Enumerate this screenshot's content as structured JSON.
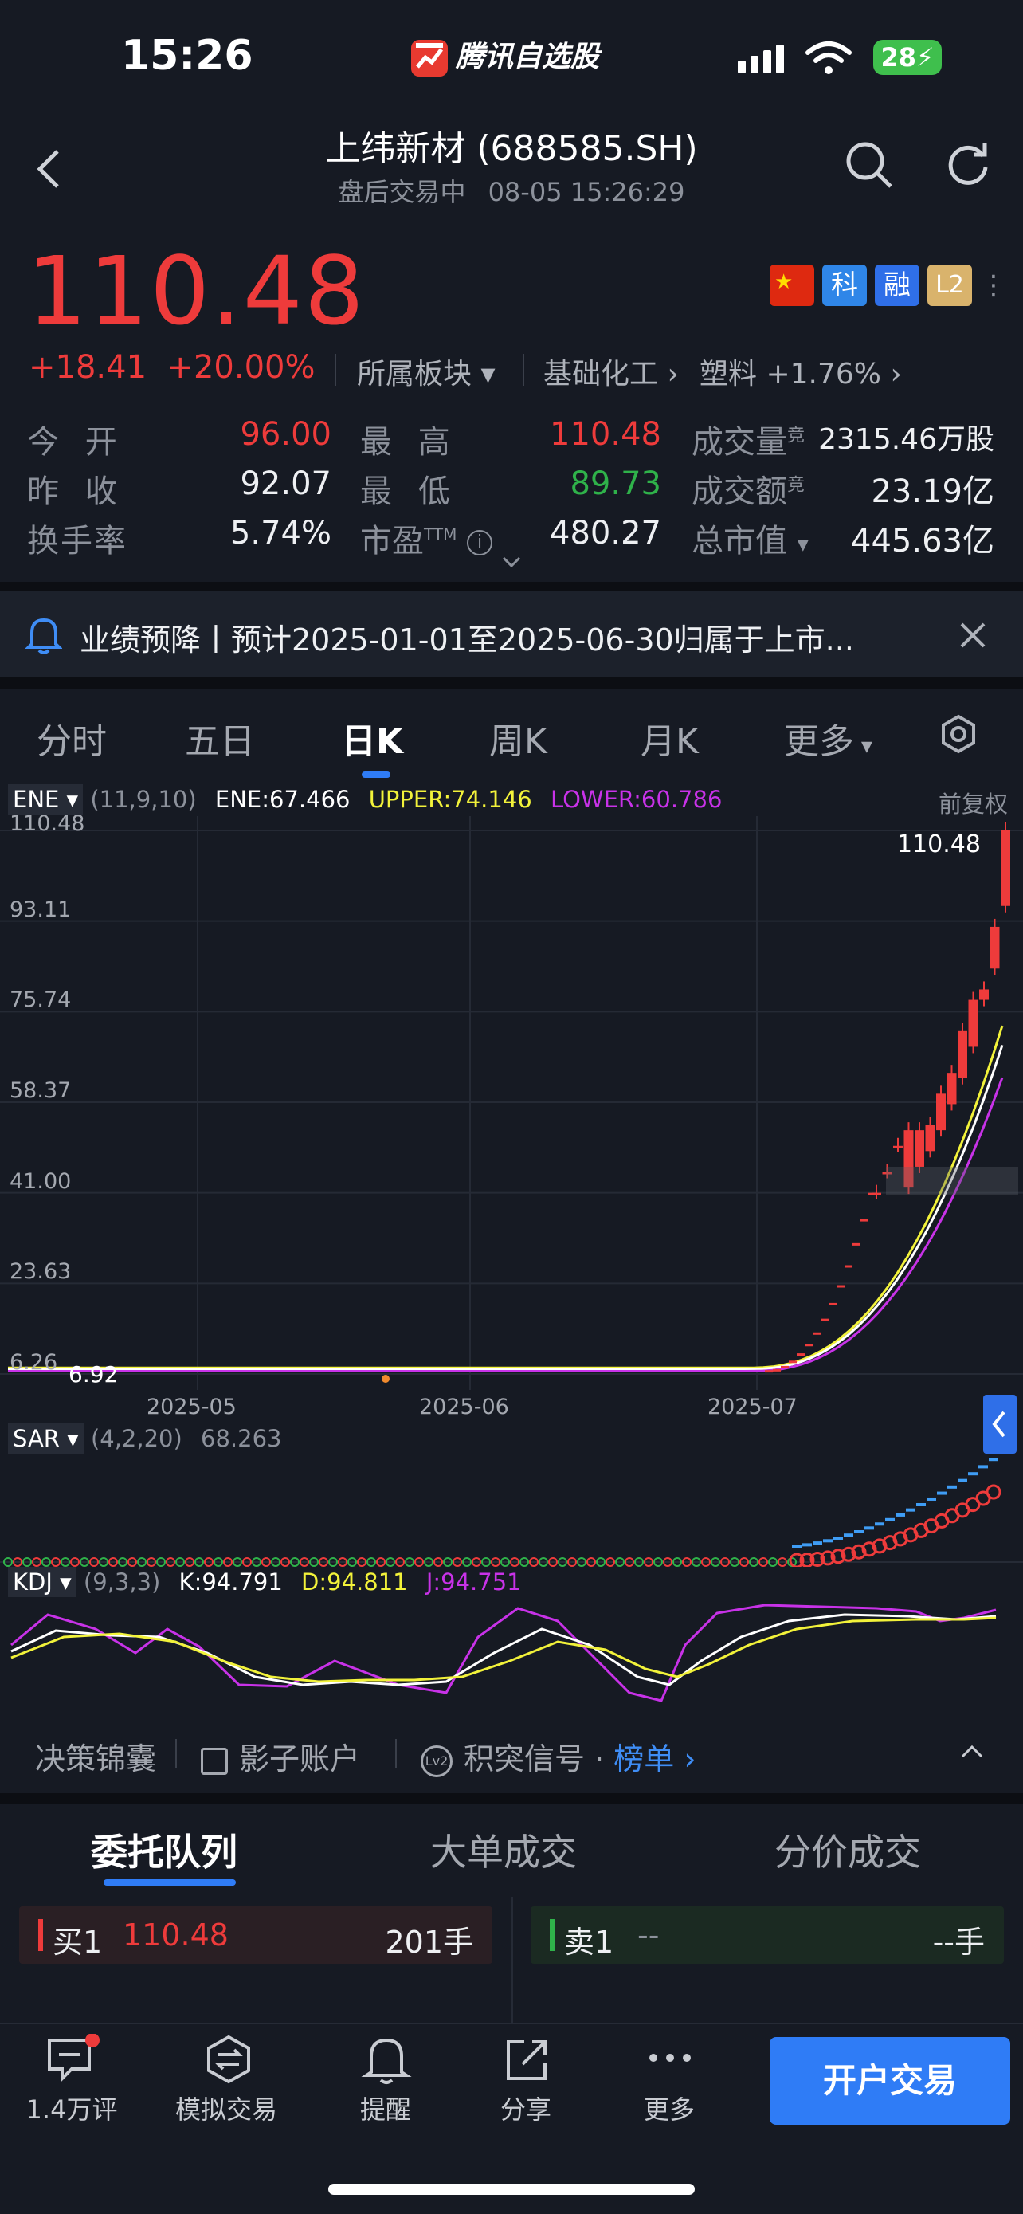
{
  "status": {
    "time": "15:26",
    "app_brand": "腾讯自选股",
    "battery": "28"
  },
  "header": {
    "title": "上纬新材 (688585.SH)",
    "session": "盘后交易中",
    "datetime": "08-05 15:26:29"
  },
  "quote": {
    "price": "110.48",
    "change": "+18.41",
    "change_pct": "+20.00%",
    "sector_label": "所属板块",
    "industry": "基础化工",
    "sub_industry": "塑料",
    "sub_industry_pct": "+1.76%",
    "badges": [
      "科",
      "融",
      "L2"
    ],
    "stats": {
      "open_label": "今 开",
      "open": "96.00",
      "high_label": "最 高",
      "high": "110.48",
      "volume_label": "成交量",
      "volume": "2315.46万股",
      "prev_close_label": "昨 收",
      "prev_close": "92.07",
      "low_label": "最 低",
      "low": "89.73",
      "amount_label": "成交额",
      "amount": "23.19亿",
      "turnover_label": "换手率",
      "turnover": "5.74%",
      "pe_label": "市盈",
      "pe_sup": "TTM",
      "pe": "480.27",
      "mcap_label": "总市值",
      "mcap": "445.63亿",
      "sup_mark": "竞"
    }
  },
  "notice": {
    "text": "业绩预降丨预计2025-01-01至2025-06-30归属于上市..."
  },
  "chart_tabs": [
    "分时",
    "五日",
    "日K",
    "周K",
    "月K",
    "更多"
  ],
  "chart_tab_active": 2,
  "chart_legend": {
    "ene_name": "ENE",
    "ene_params": "(11,9,10)",
    "ene": "ENE:67.466",
    "upper": "UPPER:74.146",
    "lower": "LOWER:60.786",
    "adjust": "前复权",
    "sar_name": "SAR",
    "sar_params": "(4,2,20)",
    "sar": "68.263",
    "kdj_name": "KDJ",
    "kdj_params": "(9,3,3)",
    "k": "K:94.791",
    "d": "D:94.811",
    "j": "J:94.751"
  },
  "chart_data": {
    "type": "candlestick",
    "y_ticks": [
      "110.48",
      "93.11",
      "75.74",
      "58.37",
      "41.00",
      "23.63",
      "6.26"
    ],
    "x_ticks": [
      "2025-05",
      "2025-06",
      "2025-07"
    ],
    "high_label": "110.48",
    "low_label": "6.92",
    "ylim": [
      6.26,
      110.48
    ],
    "candles": [
      {
        "o": 41,
        "c": 41
      },
      {
        "o": 45,
        "c": 45
      },
      {
        "o": 50,
        "c": 50
      },
      {
        "o": 42,
        "c": 53
      },
      {
        "o": 46,
        "c": 53
      },
      {
        "o": 49,
        "c": 54
      },
      {
        "o": 53,
        "c": 60
      },
      {
        "o": 58,
        "c": 64
      },
      {
        "o": 63,
        "c": 72
      },
      {
        "o": 69,
        "c": 78
      },
      {
        "o": 78,
        "c": 80
      },
      {
        "o": 84,
        "c": 92
      },
      {
        "o": 96,
        "c": 110.48
      }
    ],
    "colors": {
      "up": "#ee3b3b",
      "down": "#2fb24a",
      "ene": "#ffffff",
      "upper": "#f2f23a",
      "lower": "#c832e8"
    }
  },
  "tools": {
    "item1": "决策锦囊",
    "item2": "影子账户",
    "item3": "积突信号",
    "item3_link": "榜单"
  },
  "queue_tabs": [
    "委托队列",
    "大单成交",
    "分价成交"
  ],
  "order_book": {
    "bid_label": "买1",
    "bid_price": "110.48",
    "bid_qty": "201手",
    "ask_label": "卖1",
    "ask_price": "--",
    "ask_qty": "--手"
  },
  "bottom_nav": [
    {
      "label": "1.4万评",
      "icon": "comment-icon"
    },
    {
      "label": "模拟交易",
      "icon": "exchange-icon"
    },
    {
      "label": "提醒",
      "icon": "bell-icon"
    },
    {
      "label": "分享",
      "icon": "share-icon"
    },
    {
      "label": "更多",
      "icon": "more-icon"
    }
  ],
  "cta": "开户交易"
}
